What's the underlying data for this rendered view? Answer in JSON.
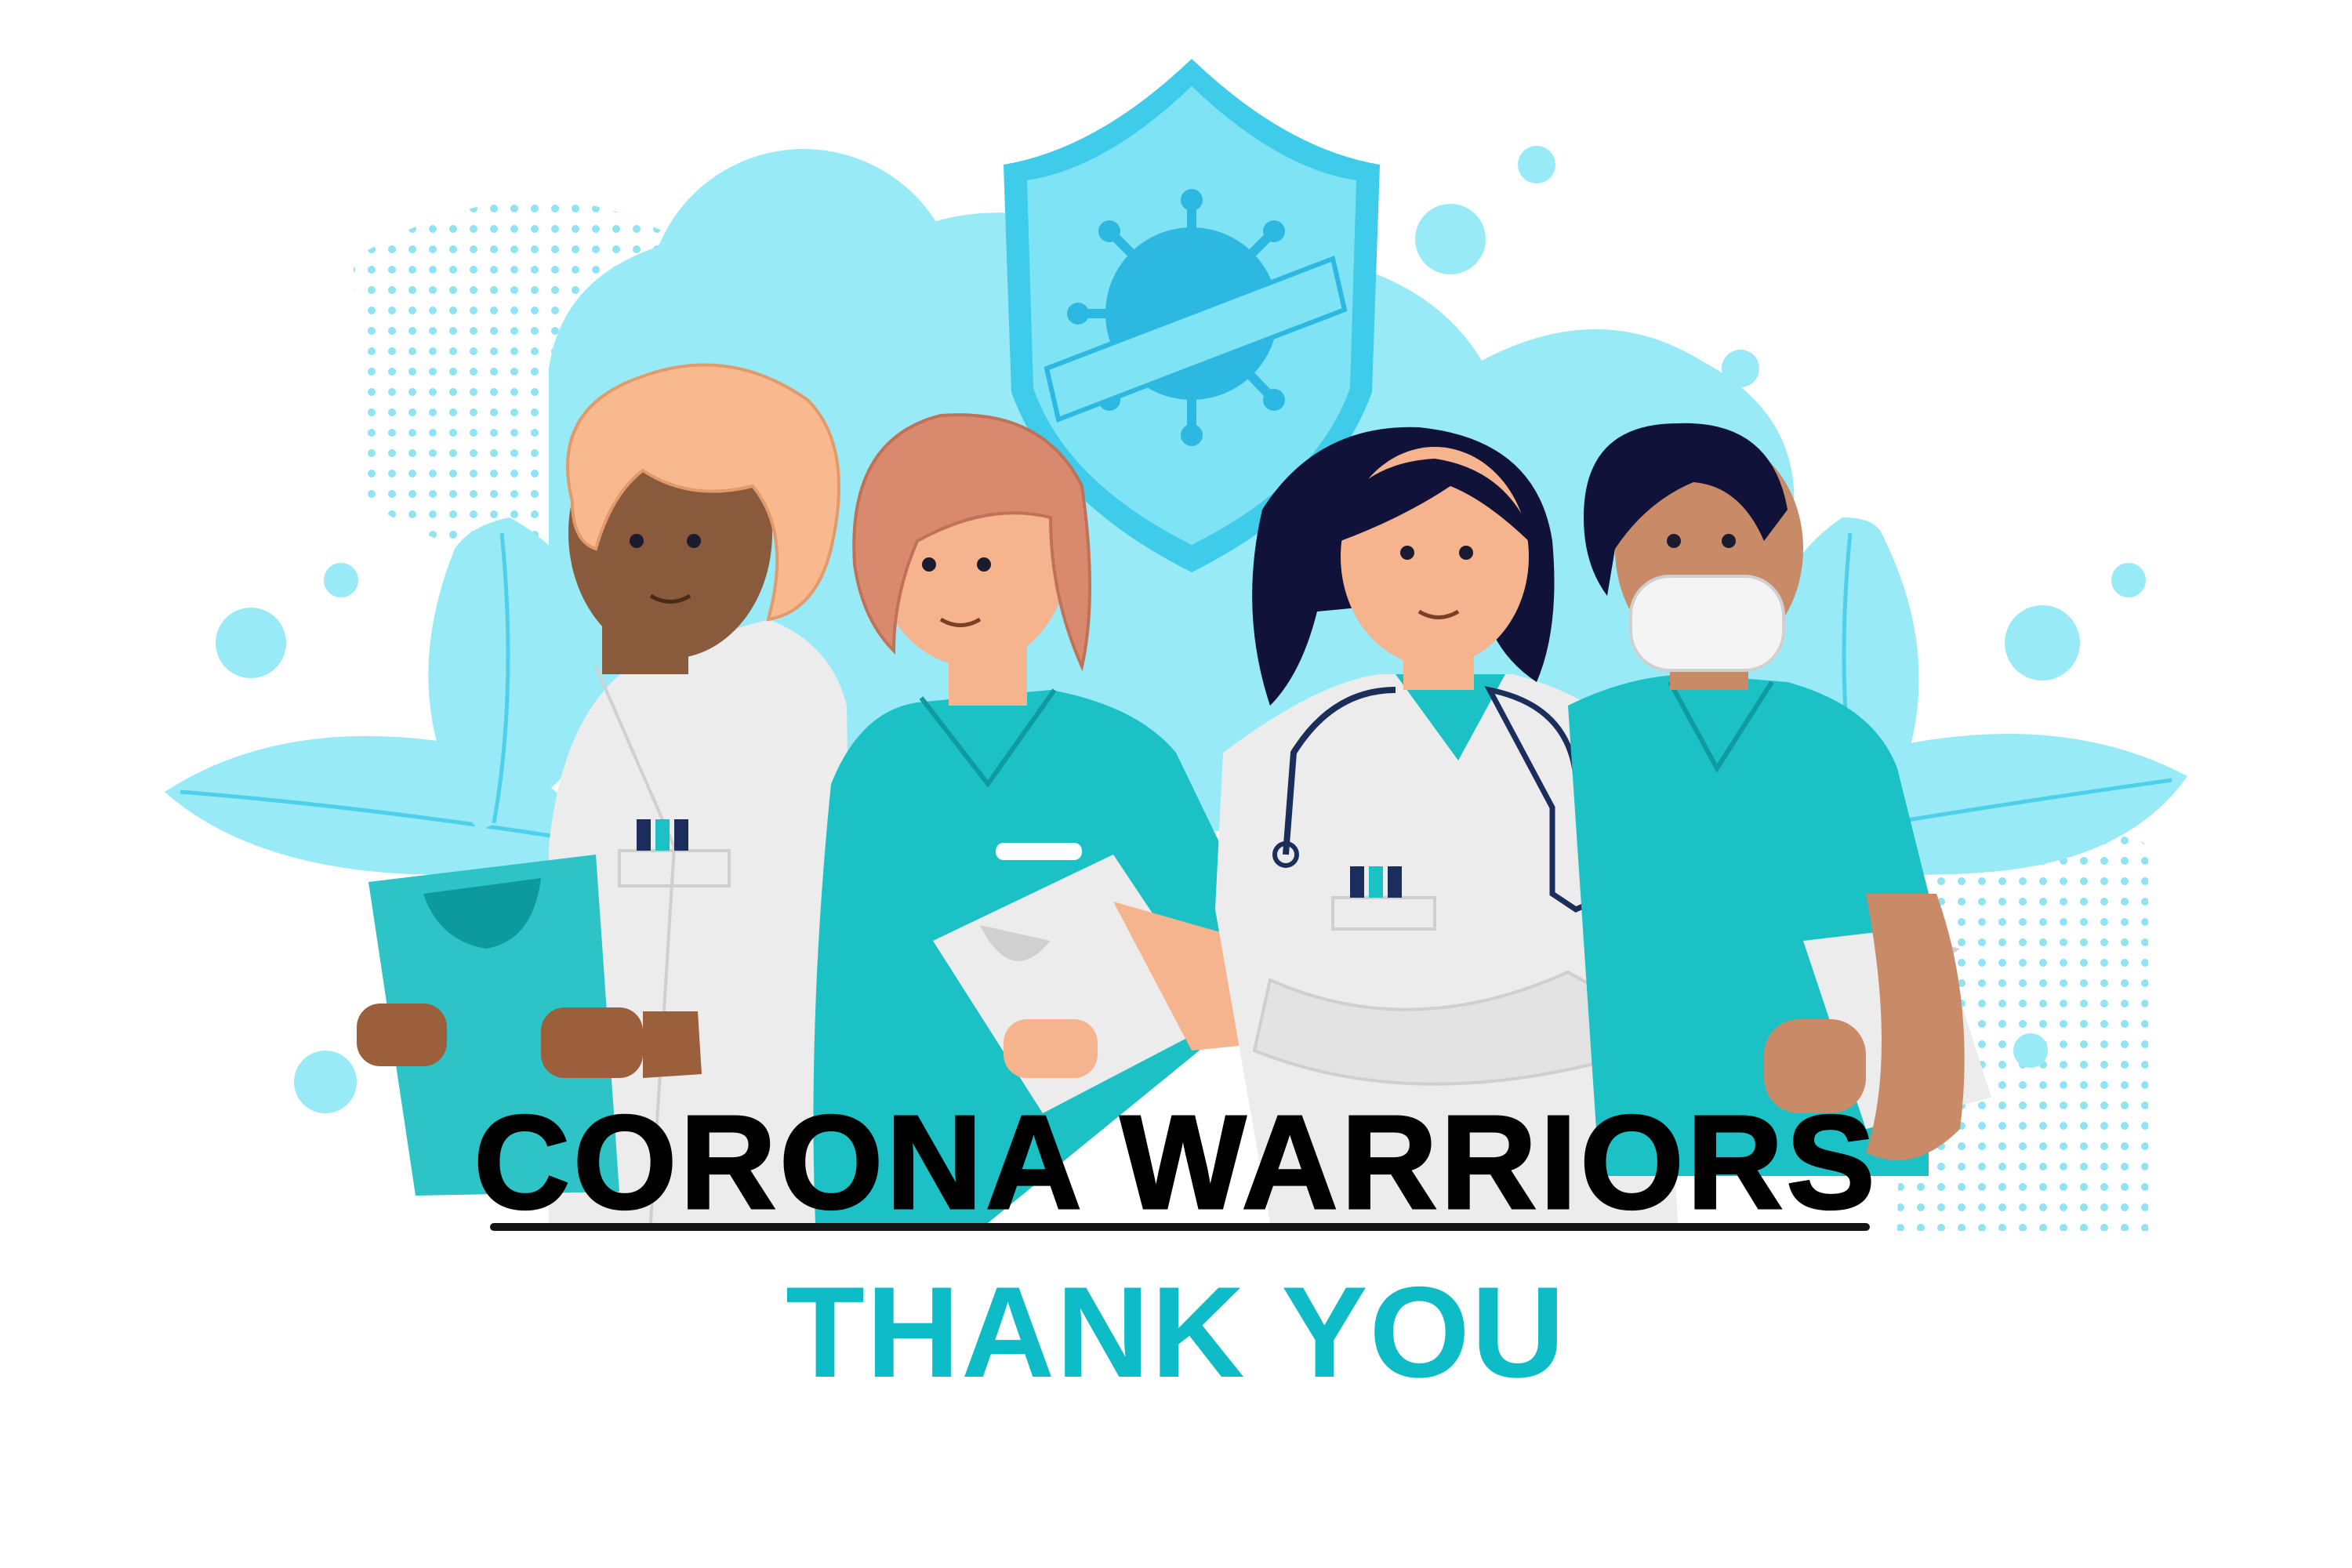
{
  "poster": {
    "title": "CORONA WARRIORS",
    "subtitle": "THANK YOU"
  },
  "illustration": {
    "figures": [
      "doctor-with-clipboard",
      "nurse-with-clipboard",
      "doctor-with-stethoscope",
      "masked-nurse"
    ],
    "emblem": "shield-virus-icon",
    "decor": [
      "leaf",
      "bubble",
      "dot-pattern"
    ]
  },
  "colors": {
    "title": "#000000",
    "subtitle": "#0dbcc6",
    "scrubs": "#1cc1c6",
    "blob": "#98eaf7",
    "shield": "#7ee3f4",
    "virus": "#2cb8e0",
    "coat": "#ececec"
  }
}
